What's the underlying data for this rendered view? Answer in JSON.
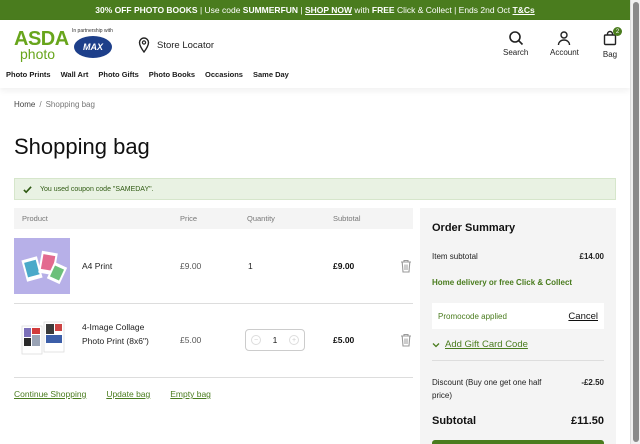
{
  "promo": {
    "part1": "30% OFF PHOTO BOOKS",
    "part2": " | Use code ",
    "code": "SUMMERFUN",
    "part3": " | ",
    "shop_now": "SHOP NOW",
    "part4": " with ",
    "free": "FREE",
    "part5": " Click & Collect | Ends 2nd Oct ",
    "tcs": "T&Cs"
  },
  "header": {
    "logo_asda": "ASDA",
    "logo_photo": "photo",
    "partner_text": "In partnership with",
    "partner_logo": "MAX",
    "store_locator": "Store Locator",
    "search_label": "Search",
    "account_label": "Account",
    "bag_label": "Bag",
    "bag_count": "2",
    "nav": [
      "Photo Prints",
      "Wall Art",
      "Photo Gifts",
      "Photo Books",
      "Occasions",
      "Same Day"
    ]
  },
  "breadcrumb": {
    "home": "Home",
    "separator": "/",
    "current": "Shopping bag"
  },
  "page_title": "Shopping bag",
  "notice": "You used coupon code \"SAMEDAY\".",
  "cart": {
    "columns": {
      "product": "Product",
      "price": "Price",
      "quantity": "Quantity",
      "subtotal": "Subtotal"
    },
    "items": [
      {
        "name": "A4 Print",
        "price": "£9.00",
        "quantity": "1",
        "subtotal": "£9.00"
      },
      {
        "name_line1": "4-Image Collage",
        "name_line2": "Photo Print (8x6\")",
        "price": "£5.00",
        "quantity": "1",
        "subtotal": "£5.00"
      }
    ],
    "links": {
      "continue": "Continue Shopping",
      "update": "Update bag",
      "empty": "Empty bag"
    }
  },
  "summary": {
    "title": "Order Summary",
    "item_subtotal_label": "Item subtotal",
    "item_subtotal_value": "£14.00",
    "delivery_note": "Home delivery or free Click & Collect",
    "promo_applied": "Promocode applied",
    "cancel": "Cancel",
    "gift_card": "Add Gift Card Code",
    "discount_label": "Discount (Buy one get one half price)",
    "discount_value": "-£2.50",
    "subtotal_label": "Subtotal",
    "subtotal_value": "£11.50"
  },
  "colors": {
    "brand_green": "#4a7c1e",
    "logo_green": "#68a51c",
    "max_blue": "#1d3f8a"
  }
}
